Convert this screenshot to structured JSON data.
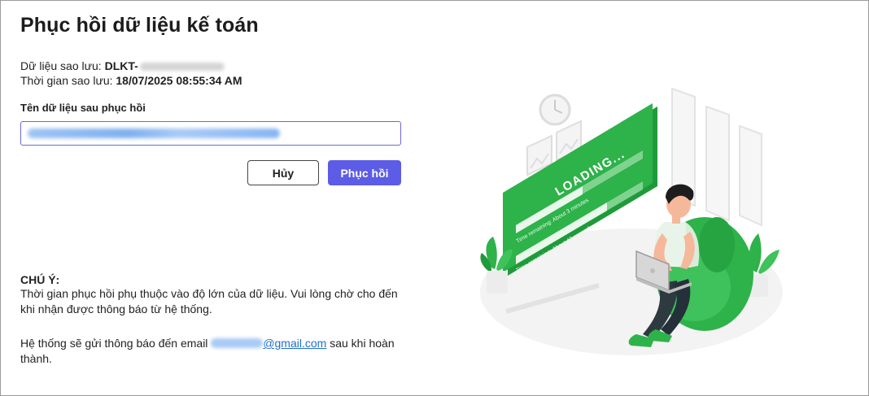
{
  "dialog": {
    "title": "Phục hồi dữ liệu kế toán",
    "backup_data_label": "Dữ liệu sao lưu:",
    "backup_data_value": "DLKT-",
    "backup_time_label": "Thời gian sao lưu:",
    "backup_time_value": "18/07/2025 08:55:34 AM",
    "restore_name_label": "Tên dữ liệu sau phục hồi",
    "restore_name_value": "",
    "cancel_label": "Hủy",
    "restore_label": "Phục hồi",
    "note_heading": "CHÚ Ý:",
    "note_text": "Thời gian phục hồi phụ thuộc vào độ lớn của dữ liệu. Vui lòng chờ cho đến khi nhận được thông báo từ hệ thống.",
    "email_prefix": "Hệ thống sẽ gửi thông báo đến email",
    "email_domain": "@gmail.com",
    "email_suffix": "sau khi hoàn thành."
  },
  "illustration": {
    "loading_text": "LOADING...",
    "progress_1_text": "Time remaining: About 3 minutes",
    "progress_2_text": "Time remaining: About 42 seconds"
  },
  "colors": {
    "accent": "#5c5ce6",
    "illustration_green": "#2eb24a",
    "link": "#1f6fd0"
  }
}
